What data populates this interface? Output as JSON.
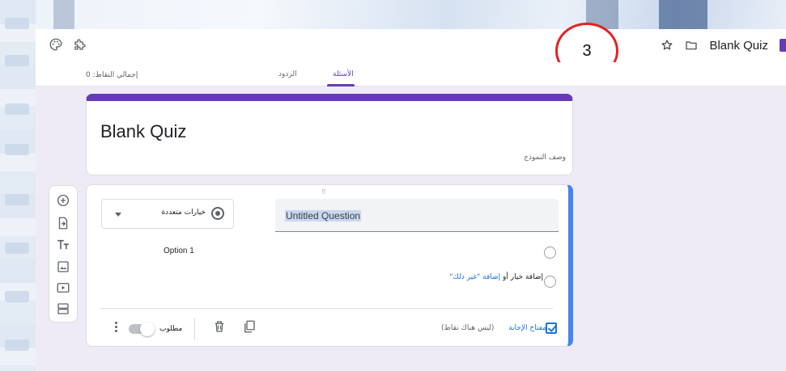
{
  "header": {
    "title": "Blank Quiz",
    "icons": [
      "palette-icon",
      "puzzle-icon",
      "star-icon",
      "folder-icon"
    ],
    "accent": "#673ab7"
  },
  "annotation": {
    "number": "3",
    "color": "#e32222"
  },
  "tabs": {
    "items": [
      {
        "label": "الأسئلة",
        "active": true
      },
      {
        "label": "الردود",
        "active": false
      }
    ],
    "total_points": "إجمالي النقاط: 0"
  },
  "form": {
    "title": "Blank Quiz",
    "description_placeholder": "وصف النموذج"
  },
  "sidebar": {
    "buttons": [
      "add-question-icon",
      "import-questions-icon",
      "add-title-icon",
      "add-image-icon",
      "add-video-icon",
      "add-section-icon"
    ]
  },
  "question": {
    "title": "Untitled Question",
    "type": "خيارات متعددة",
    "options": [
      "Option 1"
    ],
    "add_option": "إضافة خيار",
    "or": "أو",
    "add_other": "إضافة \"غير ذلك\"",
    "answer_key": "مفتاح الإجابة",
    "points": "(ليس هناك نقاط)",
    "required_label": "مطلوب",
    "required": false,
    "highlight": "#4285f4"
  }
}
